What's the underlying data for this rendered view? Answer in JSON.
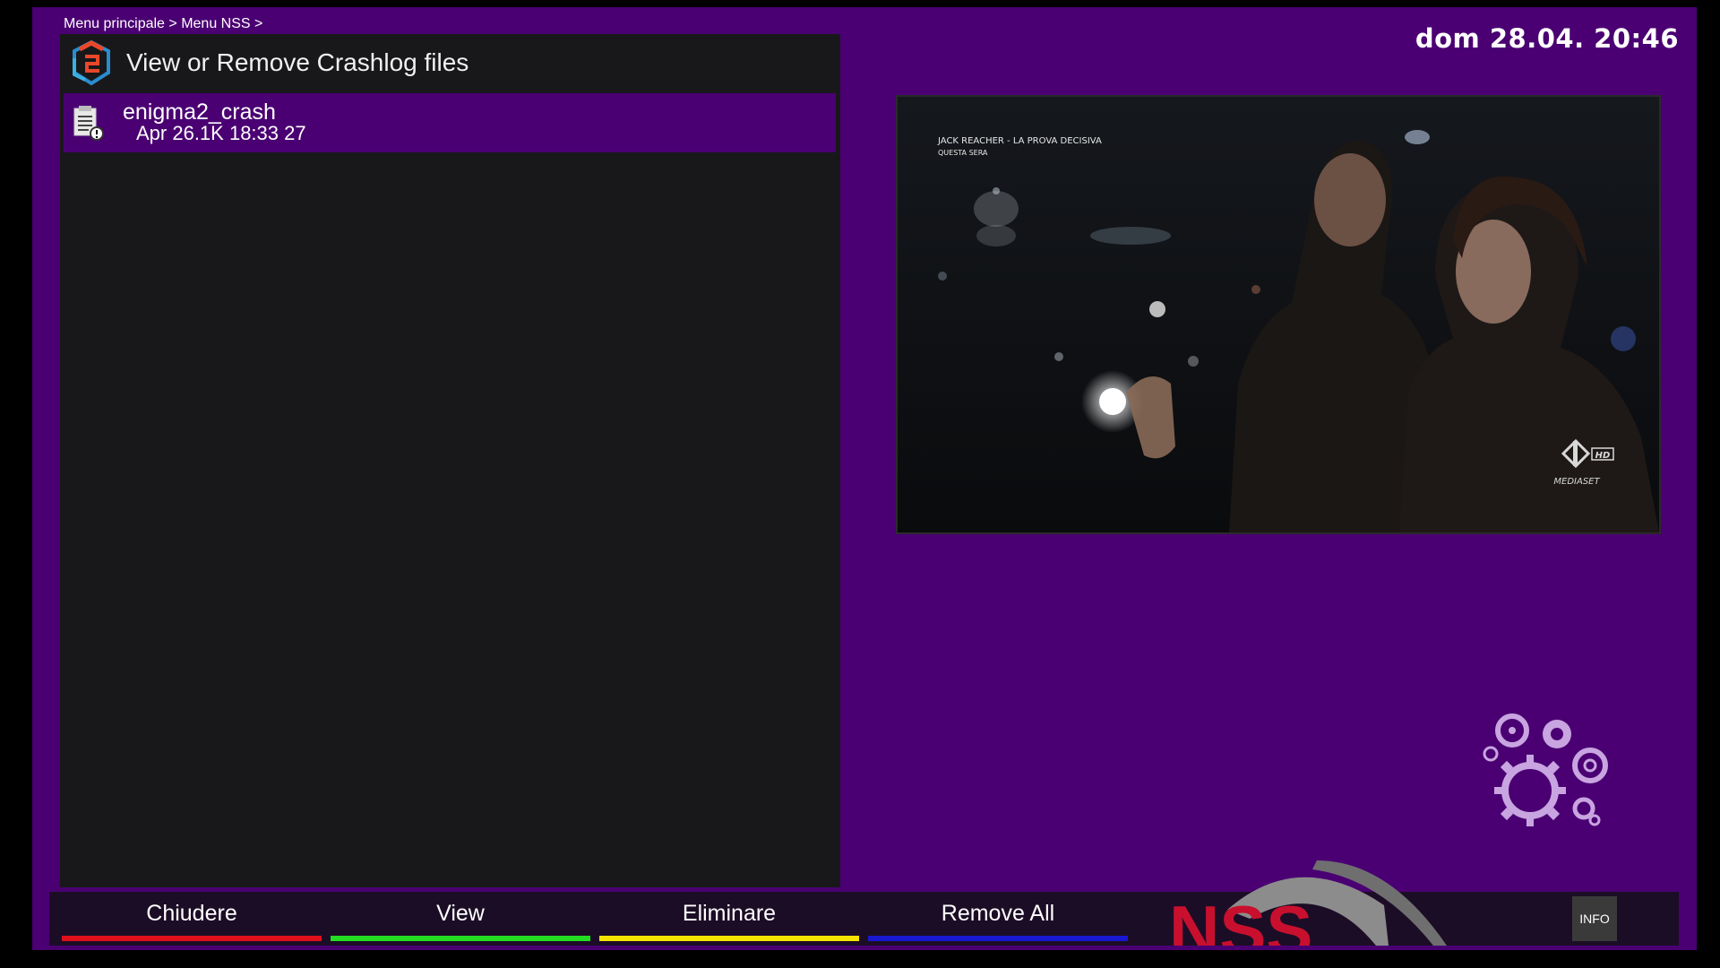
{
  "breadcrumb": "Menu principale > Menu NSS >",
  "datetime": "dom 28.04.  20:46",
  "panel": {
    "title": "View or Remove Crashlog files",
    "items": [
      {
        "name": "enigma2_crash",
        "detail": "Apr 26.1K 18:33 27"
      }
    ]
  },
  "video": {
    "overlay_title": "JACK REACHER - LA PROVA DECISIVA",
    "overlay_subtitle": "QUESTA SERA",
    "channel_hd": "HD",
    "channel_brand": "MEDIASET"
  },
  "buttons": [
    {
      "label": "Chiudere",
      "color": "#e0101a"
    },
    {
      "label": "View",
      "color": "#22dd22"
    },
    {
      "label": "Eliminare",
      "color": "#f5e400"
    },
    {
      "label": "Remove All",
      "color": "#1818d0"
    }
  ],
  "info_label": "INFO",
  "logo_text": "NSS",
  "colors": {
    "background": "#4a0072",
    "panel": "#18181b",
    "bottom_bar": "#1c0d26",
    "logo_red": "#c8102e"
  }
}
